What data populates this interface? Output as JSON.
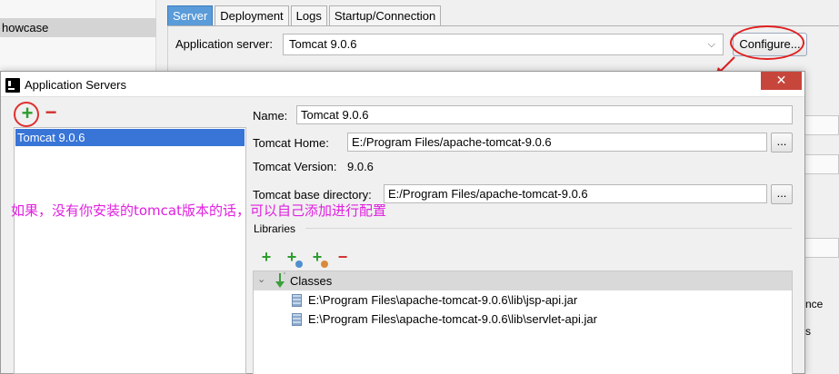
{
  "background": {
    "left_panel_item": "howcase",
    "tabs": [
      {
        "label": "Server"
      },
      {
        "label": "Deployment"
      },
      {
        "label": "Logs"
      },
      {
        "label": "Startup/Connection"
      }
    ],
    "app_server_label": "Application server:",
    "app_server_value": "Tomcat 9.0.6",
    "configure_label": "Configure...",
    "right_edge_text_1": "nce",
    "right_edge_text_2": "s"
  },
  "dialog": {
    "title": "Application Servers",
    "close_glyph": "✕",
    "add_glyph": "+",
    "remove_glyph": "−",
    "servers": [
      {
        "label": "Tomcat 9.0.6"
      }
    ],
    "name_label": "Name:",
    "name_value": "Tomcat 9.0.6",
    "home_label": "Tomcat Home:",
    "home_value": "E:/Program Files/apache-tomcat-9.0.6",
    "version_label": "Tomcat Version:",
    "version_value": "9.0.6",
    "base_dir_label": "Tomcat base directory:",
    "base_dir_value": "E:/Program Files/apache-tomcat-9.0.6",
    "browse_glyph": "...",
    "libraries_label": "Libraries",
    "classes_label": "Classes",
    "jars": [
      {
        "path": "E:\\Program Files\\apache-tomcat-9.0.6\\lib\\jsp-api.jar"
      },
      {
        "path": "E:\\Program Files\\apache-tomcat-9.0.6\\lib\\servlet-api.jar"
      }
    ]
  },
  "annotation_text": "如果，没有你安装的tomcat版本的话，可以自己添加进行配置",
  "colors": {
    "selection": "#3875d7",
    "annotation": "#e020e0",
    "highlight_circle": "#e02020",
    "add_green": "#2e9c2e",
    "remove_red": "#d23030"
  }
}
